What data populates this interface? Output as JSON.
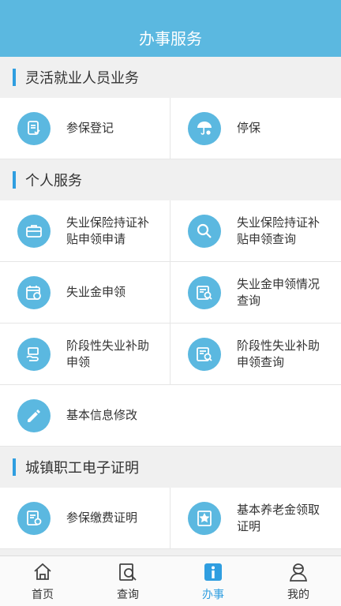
{
  "header": {
    "title": "办事服务"
  },
  "sections": [
    {
      "title": "灵活就业人员业务",
      "items": [
        {
          "label": "参保登记",
          "icon": "register-icon"
        },
        {
          "label": "停保",
          "icon": "umbrella-icon"
        }
      ]
    },
    {
      "title": "个人服务",
      "items": [
        {
          "label": "失业保险持证补贴申领申请",
          "icon": "briefcase-icon"
        },
        {
          "label": "失业保险持证补贴申领查询",
          "icon": "search-icon"
        },
        {
          "label": "失业金申领",
          "icon": "calendar-money-icon"
        },
        {
          "label": "失业金申领情况查询",
          "icon": "document-search-icon"
        },
        {
          "label": "阶段性失业补助申领",
          "icon": "hand-money-icon"
        },
        {
          "label": "阶段性失业补助申领查询",
          "icon": "document-search-icon"
        },
        {
          "label": "基本信息修改",
          "icon": "pencil-icon"
        }
      ]
    },
    {
      "title": "城镇职工电子证明",
      "items": [
        {
          "label": "参保缴费证明",
          "icon": "certificate-icon"
        },
        {
          "label": "基本养老金领取证明",
          "icon": "award-icon"
        }
      ]
    }
  ],
  "tabbar": [
    {
      "label": "首页",
      "icon": "home-icon",
      "active": false
    },
    {
      "label": "查询",
      "icon": "query-icon",
      "active": false
    },
    {
      "label": "办事",
      "icon": "info-icon",
      "active": true
    },
    {
      "label": "我的",
      "icon": "user-icon",
      "active": false
    }
  ],
  "colors": {
    "primary": "#5bb8e0",
    "accent": "#2f9ee0"
  }
}
